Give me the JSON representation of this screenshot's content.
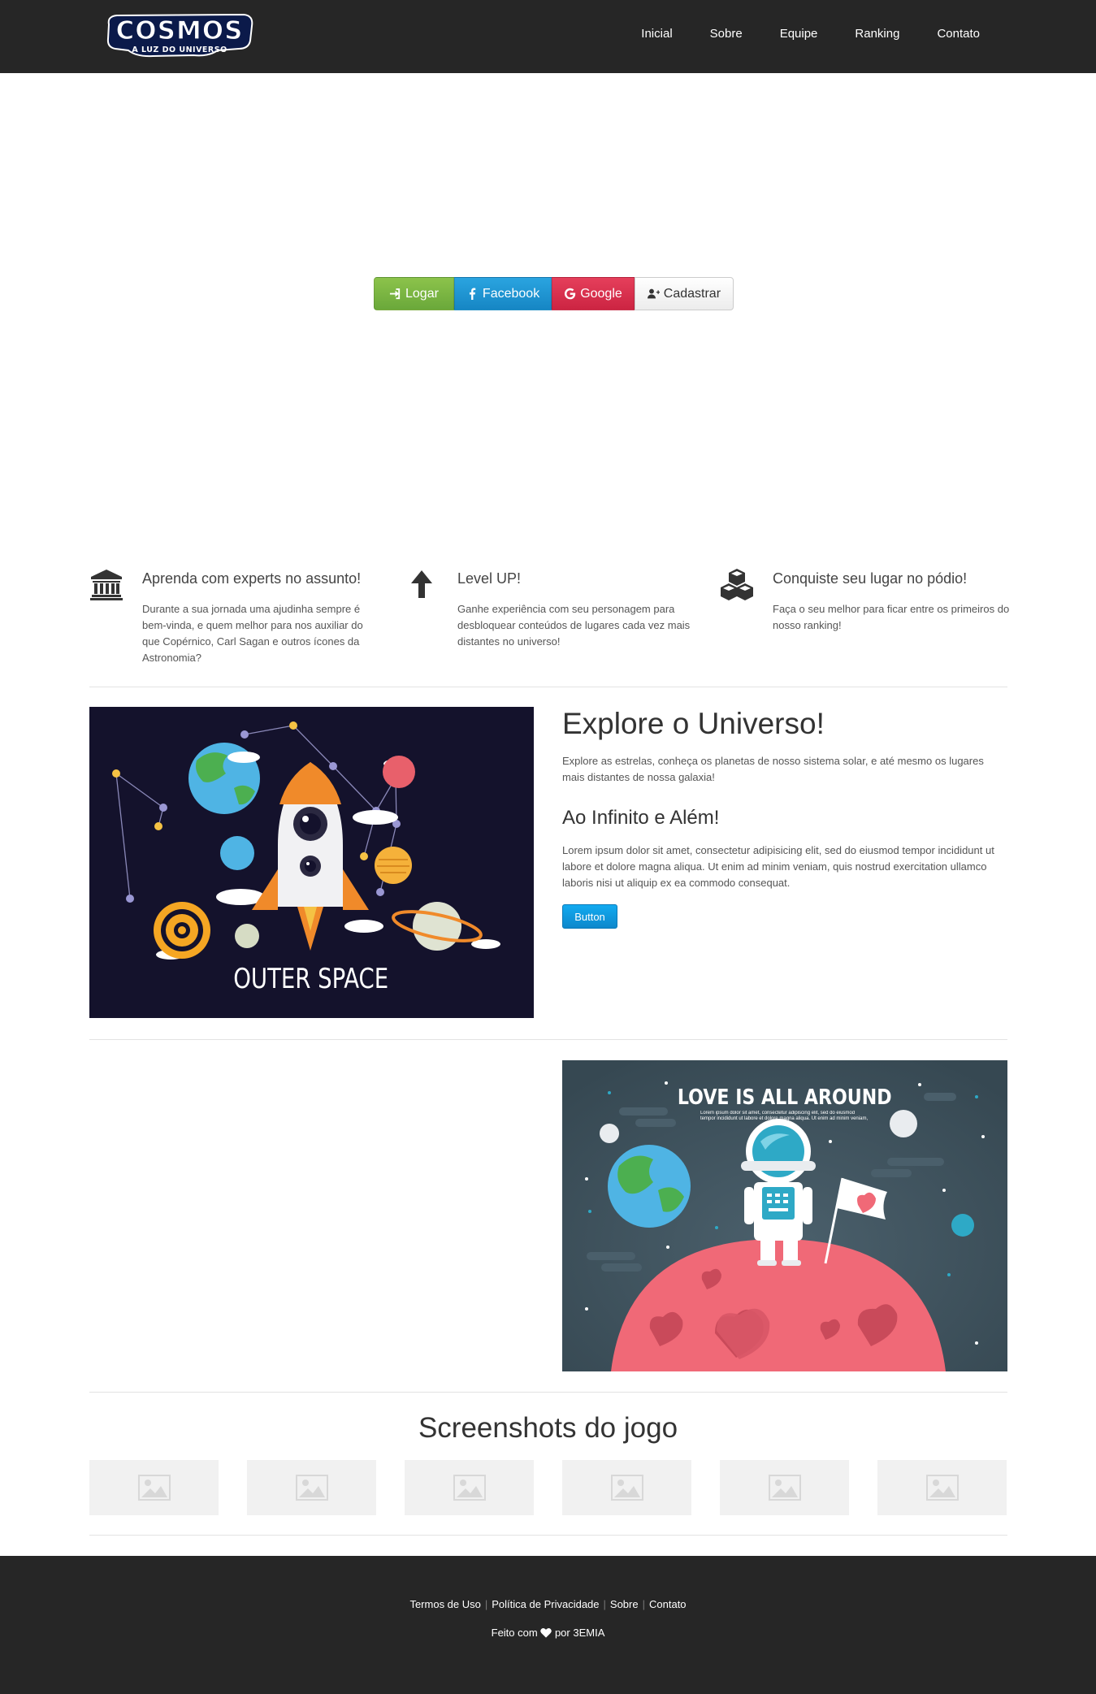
{
  "brand": {
    "logo_text": "COSMOS",
    "logo_subtitle": "A LUZ DO UNIVERSO"
  },
  "nav": {
    "items": [
      {
        "label": "Inicial"
      },
      {
        "label": "Sobre"
      },
      {
        "label": "Equipe"
      },
      {
        "label": "Ranking"
      },
      {
        "label": "Contato"
      }
    ]
  },
  "auth": {
    "logar": "Logar",
    "facebook": "Facebook",
    "google": "Google",
    "cadastrar": "Cadastrar"
  },
  "features": [
    {
      "icon": "bank-icon",
      "title": "Aprenda com experts no assunto!",
      "text": "Durante a sua jornada uma ajudinha sempre é bem-vinda, e quem melhor para nos auxiliar do que Copérnico, Carl Sagan e outros ícones da Astronomia?"
    },
    {
      "icon": "arrow-up-icon",
      "title": "Level UP!",
      "text": "Ganhe experiência com seu personagem para desbloquear conteúdos de lugares cada vez mais distantes no universo!"
    },
    {
      "icon": "cubes-icon",
      "title": "Conquiste seu lugar no pódio!",
      "text": "Faça o seu melhor para ficar entre os primeiros do nosso ranking!"
    }
  ],
  "explore": {
    "title": "Explore o Universo!",
    "text": "Explore as estrelas, conheça os planetas de nosso sistema solar, e até mesmo os lugares mais distantes de nossa galaxia!",
    "subtitle": "Ao Infinito e Além!",
    "lorem": "Lorem ipsum dolor sit amet, consectetur adipisicing elit, sed do eiusmod tempor incididunt ut labore et dolore magna aliqua. Ut enim ad minim veniam, quis nostrud exercitation ullamco laboris nisi ut aliquip ex ea commodo consequat.",
    "button": "Button",
    "image_caption": "OUTER SPACE"
  },
  "love": {
    "title": "LOVE IS ALL AROUND",
    "text": "Lorem ipsum dolor sit amet, consectetur adipiscing elit, sed do eiusmod tempor incididunt ut labore et dolore magna aliqua. Ut enim ad minim veniam, quis nostrud exercitation ullamco laboris nisi ut aliquip ex ea"
  },
  "screenshots": {
    "title": "Screenshots do jogo",
    "count": 6
  },
  "footer": {
    "links": [
      {
        "label": "Termos de Uso"
      },
      {
        "label": "Política de Privacidade"
      },
      {
        "label": "Sobre"
      },
      {
        "label": "Contato"
      }
    ],
    "credit_before": "Feito com",
    "credit_after": "por 3EMIA"
  },
  "colors": {
    "navbar": "#262626",
    "logar": "#7ab643",
    "facebook": "#1e96d6",
    "google": "#d9304e",
    "accent_blue": "#0f9be0"
  }
}
